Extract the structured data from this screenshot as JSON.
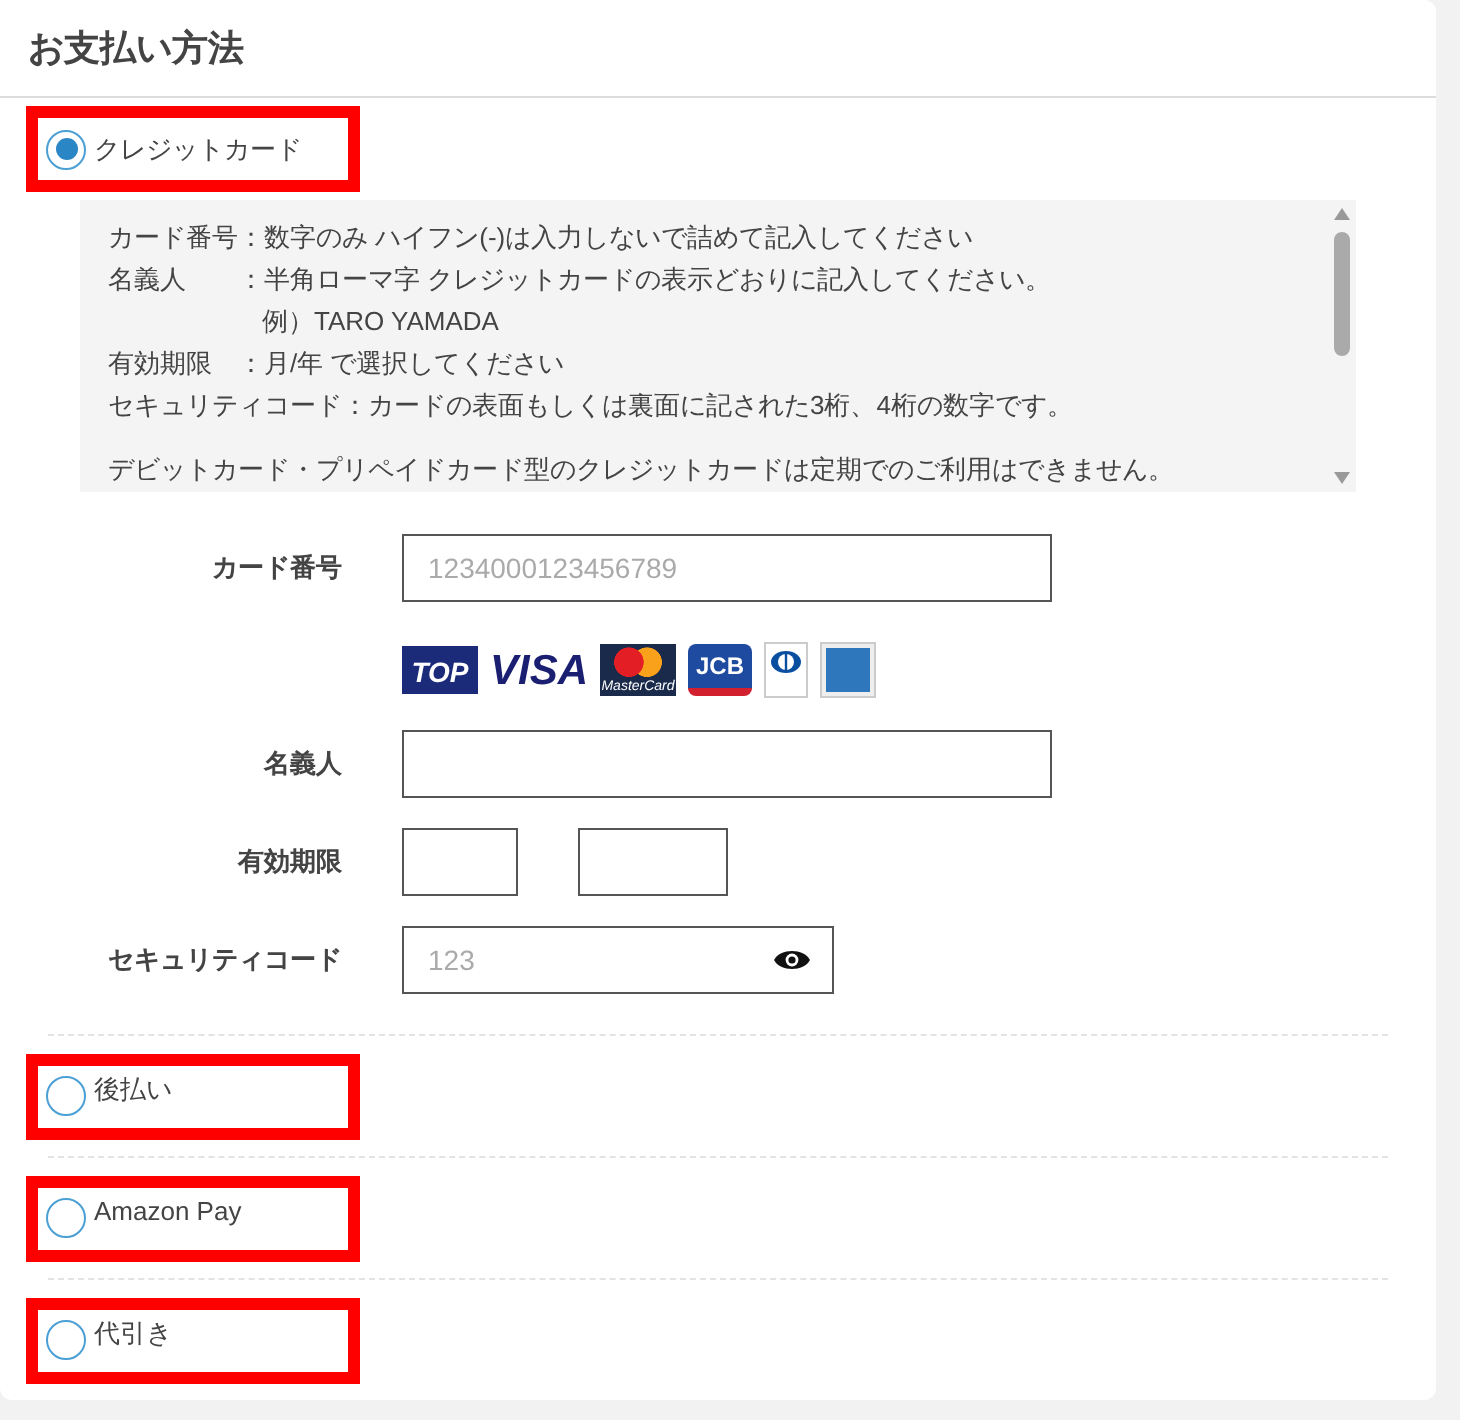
{
  "section": {
    "title": "お支払い方法"
  },
  "notes": [
    "カード番号：数字のみ ハイフン(-)は入力しないで詰めて記入してください",
    "名義人　　：半角ローマ字 クレジットカードの表示どおりに記入してください。",
    "例）TARO YAMADA",
    "有効期限　：月/年 で選択してください",
    "セキュリティコード：カードの表面もしくは裏面に記された3桁、4桁の数字です。",
    "デビットカード・プリペイドカード型のクレジットカードは定期でのご利用はできません。"
  ],
  "form": {
    "card_number": {
      "label": "カード番号",
      "placeholder": "1234000123456789"
    },
    "card_brands": [
      {
        "kind": "top",
        "label": "TOP"
      },
      {
        "kind": "visa",
        "label": "VISA"
      },
      {
        "kind": "master",
        "label": "MasterCard"
      },
      {
        "kind": "jcb",
        "label": "JCB"
      },
      {
        "kind": "diners"
      },
      {
        "kind": "amex"
      }
    ],
    "holder": {
      "label": "名義人"
    },
    "expiry": {
      "label": "有効期限"
    },
    "security_code": {
      "label": "セキュリティコード",
      "placeholder": "123"
    }
  },
  "options": [
    {
      "label": "クレジットカード",
      "selected": true
    },
    {
      "label": "後払い",
      "selected": false
    },
    {
      "label": "Amazon Pay",
      "selected": false
    },
    {
      "label": "代引き",
      "selected": false
    }
  ]
}
